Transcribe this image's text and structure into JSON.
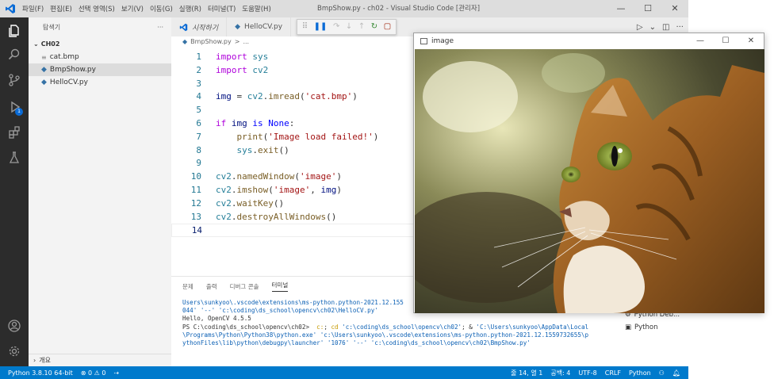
{
  "titlebar": {
    "menus": [
      "파일(F)",
      "편집(E)",
      "선택 영역(S)",
      "보기(V)",
      "이동(G)",
      "실행(R)",
      "터미널(T)",
      "도움말(H)"
    ],
    "title": "BmpShow.py - ch02 - Visual Studio Code [관리자]",
    "minimize": "—",
    "maximize": "☐",
    "close": "✕"
  },
  "explorer": {
    "header": "탐색기",
    "more": "···",
    "folder": "CH02",
    "files": [
      {
        "name": "cat.bmp",
        "icon": "≡"
      },
      {
        "name": "BmpShow.py",
        "icon": "python"
      },
      {
        "name": "HelloCV.py",
        "icon": "python"
      }
    ],
    "bottom_section": "개요"
  },
  "tabs": [
    {
      "label": "시작하기"
    },
    {
      "label": "HelloCV.py"
    }
  ],
  "breadcrumb": {
    "file": "BmpShow.py",
    "sep": ">",
    "rest": "..."
  },
  "code_lines": [
    {
      "n": "1",
      "html": "<span class='kw'>import</span> <span class='mod'>sys</span>"
    },
    {
      "n": "2",
      "html": "<span class='kw'>import</span> <span class='mod'>cv2</span>"
    },
    {
      "n": "3",
      "html": ""
    },
    {
      "n": "4",
      "html": "<span class='var'>img</span> = <span class='mod'>cv2</span>.<span class='fn'>imread</span>(<span class='st'>'cat.bmp'</span>)"
    },
    {
      "n": "5",
      "html": ""
    },
    {
      "n": "6",
      "html": "<span class='kw'>if</span> <span class='var'>img</span> <span class='kc'>is</span> <span class='kc'>None</span>:"
    },
    {
      "n": "7",
      "html": "    <span class='fn'>print</span>(<span class='st'>'Image load failed!'</span>)"
    },
    {
      "n": "8",
      "html": "    <span class='mod'>sys</span>.<span class='fn'>exit</span>()"
    },
    {
      "n": "9",
      "html": ""
    },
    {
      "n": "10",
      "html": "<span class='mod'>cv2</span>.<span class='fn'>namedWindow</span>(<span class='st'>'image'</span>)"
    },
    {
      "n": "11",
      "html": "<span class='mod'>cv2</span>.<span class='fn'>imshow</span>(<span class='st'>'image'</span>, <span class='var'>img</span>)"
    },
    {
      "n": "12",
      "html": "<span class='mod'>cv2</span>.<span class='fn'>waitKey</span>()"
    },
    {
      "n": "13",
      "html": "<span class='mod'>cv2</span>.<span class='fn'>destroyAllWindows</span>()"
    },
    {
      "n": "14",
      "html": ""
    }
  ],
  "panel": {
    "tabs": [
      "문제",
      "출력",
      "디버그 콘솔",
      "터미널"
    ],
    "terminal_lines": [
      "<span class='tb'>Users\\sunkyoo\\.vscode\\extensions\\ms-python.python-2021.12.155</span>",
      "<span class='tb'>044' '--' 'c:\\coding\\ds_school\\opencv\\ch02\\HelloCV.py'</span>",
      "Hello, OpenCV 4.5.5",
      "PS C:\\coding\\ds_school\\opencv\\ch02&gt;  <span class='ty'>c:</span>; <span class='ty'>cd</span> <span class='tb'>'c:\\coding\\ds_school\\opencv\\ch02'</span>; &amp; <span class='tb'>'C:\\Users\\sunkyoo\\AppData\\Local</span>",
      "<span class='tb'>\\Programs\\Python\\Python38\\python.exe' 'c:\\Users\\sunkyoo\\.vscode\\extensions\\ms-python.python-2021.12.1559732655\\p</span>",
      "<span class='tb'>ythonFiles\\lib\\python\\debugpy\\launcher' '1076' '--' 'c:\\coding\\ds_school\\opencv\\ch02\\BmpShow.py'</span>"
    ],
    "terminal_list": [
      "Python Deb...",
      "Python"
    ]
  },
  "statusbar": {
    "python": "Python 3.8.10 64-bit",
    "problems": "⊗ 0 ⚠ 0",
    "position": "줄 14, 열 1",
    "spaces": "공백: 4",
    "encoding": "UTF-8",
    "eol": "CRLF",
    "language": "Python"
  },
  "image_window": {
    "title": "image",
    "minimize": "—",
    "maximize": "☐",
    "close": "✕"
  }
}
